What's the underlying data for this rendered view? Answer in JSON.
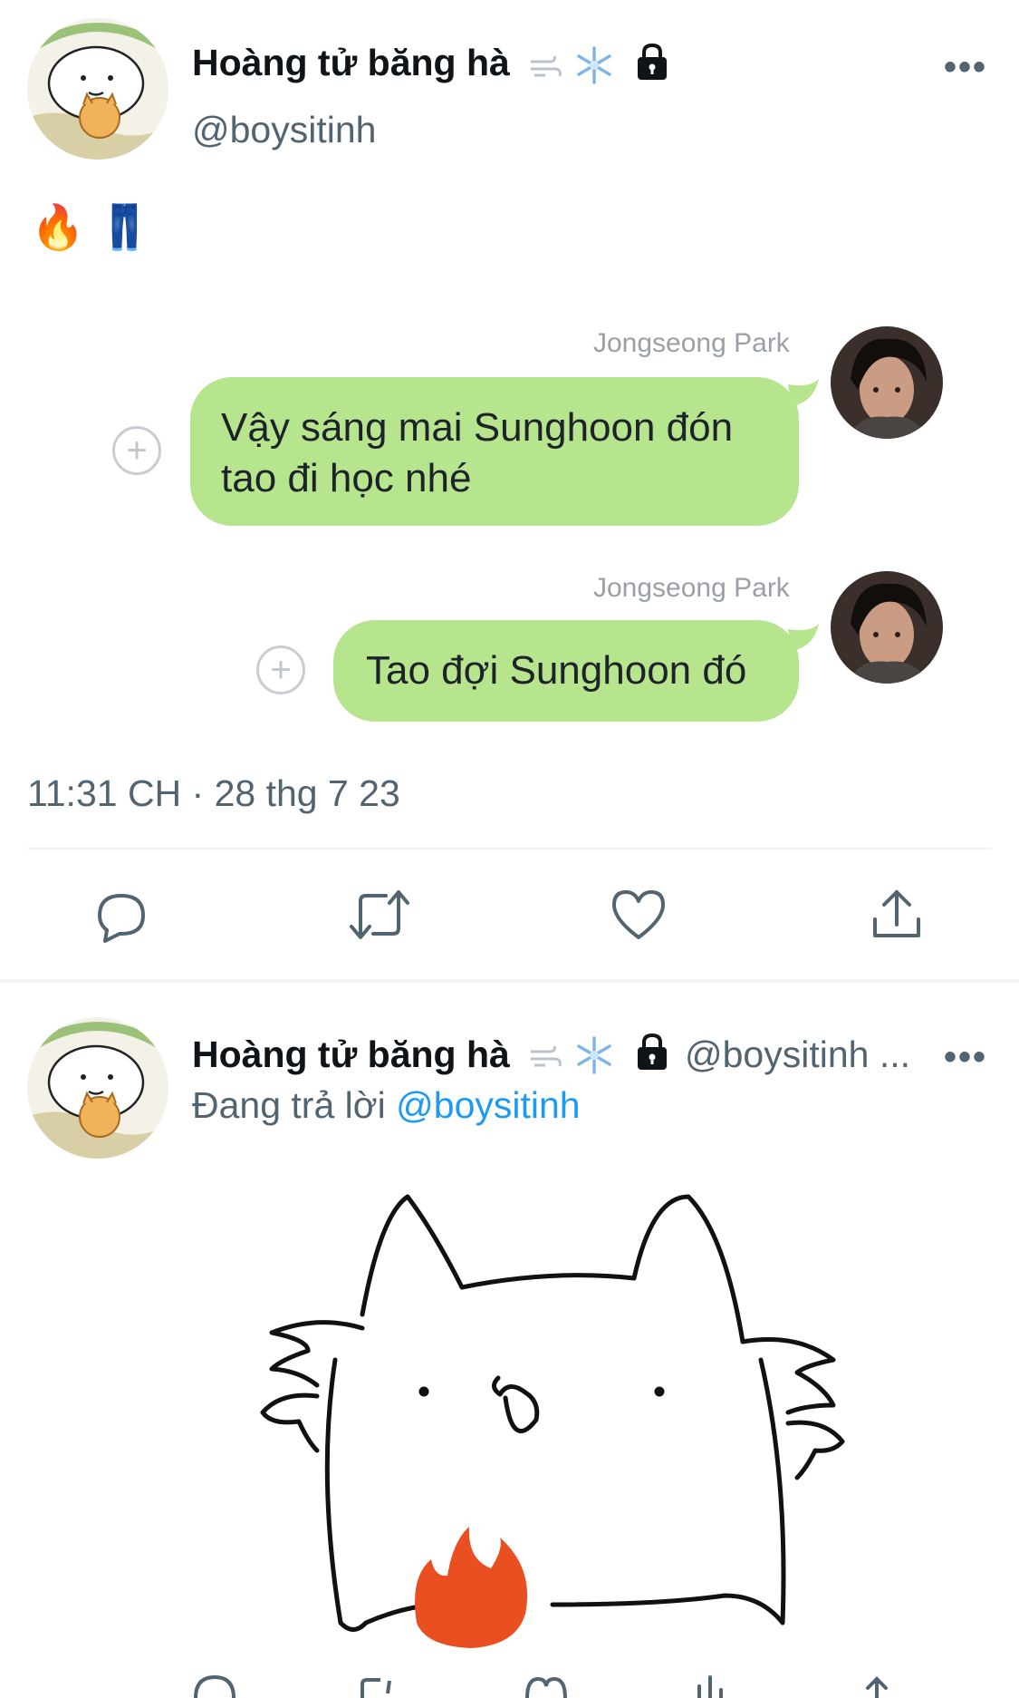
{
  "tweet": {
    "author_name": "Hoàng tử băng hà",
    "author_handle": "@boysitinh",
    "more_label": "•••",
    "body_emoji": "🔥👖",
    "chat": [
      {
        "sender": "Jongseong Park",
        "message_line1": "Vậy sáng mai Sunghoon đón",
        "message_line2": "tao đi học nhé"
      },
      {
        "sender": "Jongseong Park",
        "message_line1": "Tao đợi Sunghoon đó"
      }
    ],
    "timestamp": "11:31 CH · 28 thg 7 23",
    "actions": [
      "reply-icon",
      "retweet-icon",
      "like-icon",
      "share-icon"
    ]
  },
  "reply": {
    "author_name": "Hoàng tử băng hà",
    "author_handle": "@boysitinh ...",
    "more_label": "•••",
    "replying_prefix": "Đang trả lời",
    "replying_to": "@boysitinh"
  },
  "colors": {
    "bubble": "#b6e58d",
    "link": "#1d9bf0",
    "flame": "#ea4f22"
  }
}
